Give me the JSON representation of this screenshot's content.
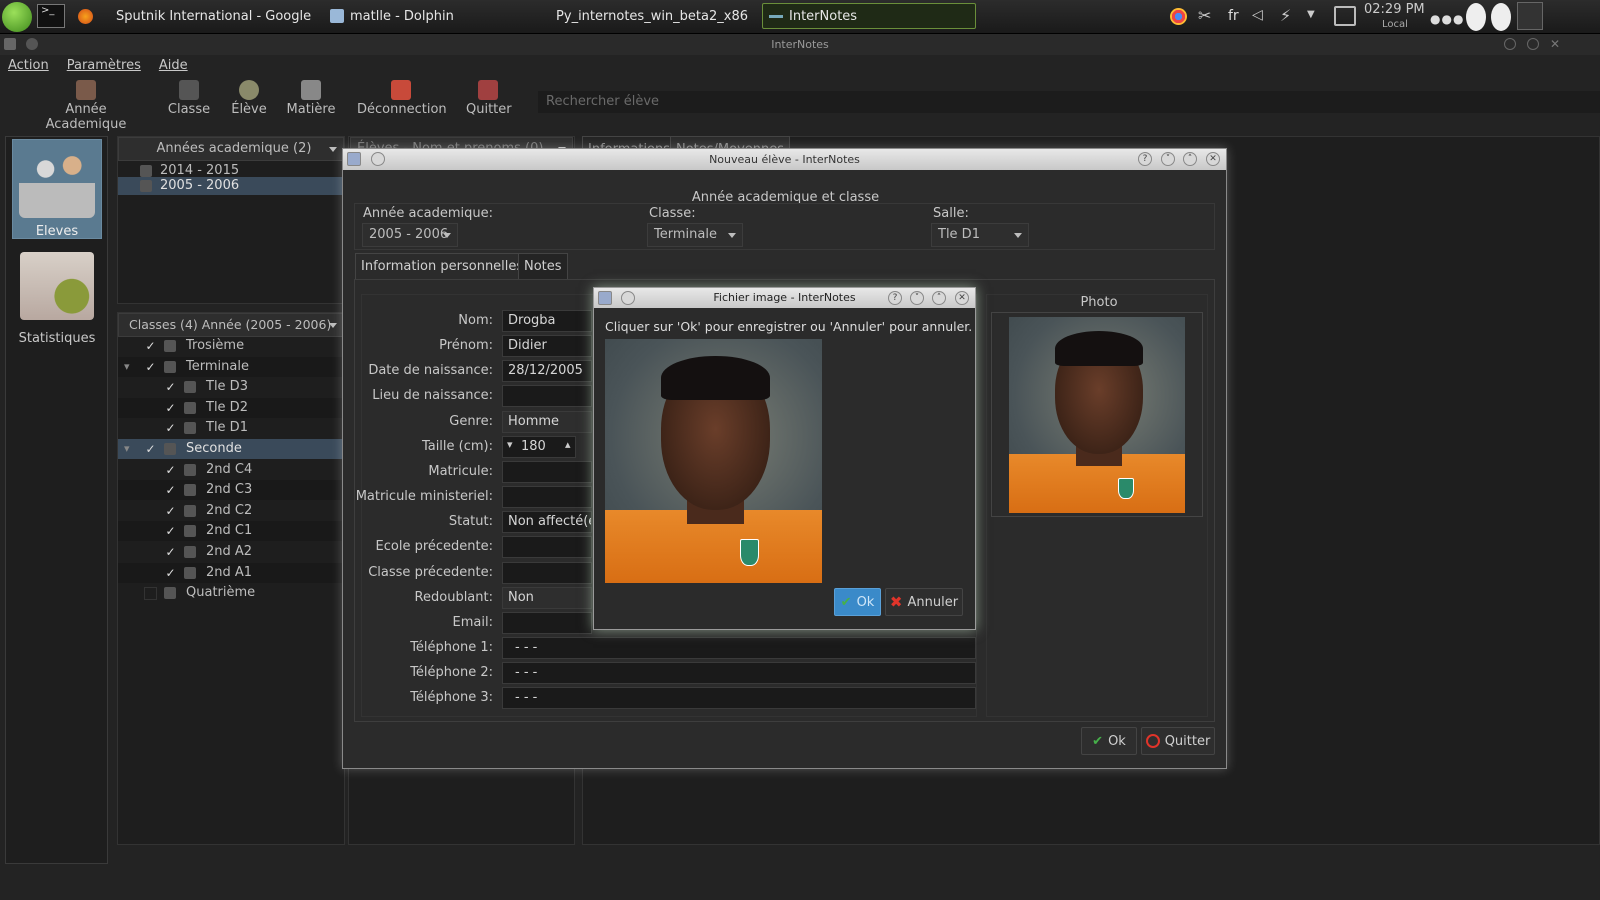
{
  "taskbar": {
    "tasks": [
      "Sputnik International - Google",
      "matlle - Dolphin",
      "Py_internotes_win_beta2_x86",
      "InterNotes"
    ],
    "lang": "fr",
    "clock": "02:29 PM",
    "clock_sub": "Local"
  },
  "app": {
    "title": "InterNotes",
    "menu": [
      "Action",
      "Paramètres",
      "Aide"
    ],
    "toolbar": [
      "Année Academique",
      "Classe",
      "Élève",
      "Matière",
      "Déconnection",
      "Quitter"
    ],
    "search_placeholder": "Rechercher élève",
    "nav": [
      "Eleves",
      "Statistiques"
    ]
  },
  "years_panel": {
    "header": "Années academique (2)",
    "items": [
      "2014 - 2015",
      "2005 - 2006"
    ],
    "selected_index": 1
  },
  "classes_panel": {
    "header": "Classes (4) Année (2005 - 2006)",
    "rows": [
      {
        "label": "Trosième",
        "level": 0,
        "checked": true,
        "expandable": false
      },
      {
        "label": "Terminale",
        "level": 0,
        "checked": true,
        "expandable": true
      },
      {
        "label": "Tle D3",
        "level": 1,
        "checked": true
      },
      {
        "label": "Tle D2",
        "level": 1,
        "checked": true
      },
      {
        "label": "Tle D1",
        "level": 1,
        "checked": true
      },
      {
        "label": "Seconde",
        "level": 0,
        "checked": true,
        "expandable": true,
        "selected": true
      },
      {
        "label": "2nd C4",
        "level": 1,
        "checked": true
      },
      {
        "label": "2nd C3",
        "level": 1,
        "checked": true
      },
      {
        "label": "2nd C2",
        "level": 1,
        "checked": true
      },
      {
        "label": "2nd C1",
        "level": 1,
        "checked": true
      },
      {
        "label": "2nd A2",
        "level": 1,
        "checked": true
      },
      {
        "label": "2nd A1",
        "level": 1,
        "checked": true
      },
      {
        "label": "Quatrième",
        "level": 0,
        "checked": false,
        "expandable": false
      }
    ]
  },
  "background_tabs": [
    "Élèves - Nom et prenoms (0)",
    "Informations",
    "Notes/Moyennes"
  ],
  "new_student_dialog": {
    "title": "Nouveau élève - InterNotes",
    "section_title": "Année academique et classe",
    "year_label": "Année academique:",
    "year_value": "2005 - 2006",
    "class_label": "Classe:",
    "class_value": "Terminale",
    "room_label": "Salle:",
    "room_value": "Tle D1",
    "tabs": [
      "Information personnelles",
      "Notes"
    ],
    "fields": [
      {
        "label": "Nom:",
        "value": "Drogba"
      },
      {
        "label": "Prénom:",
        "value": "Didier"
      },
      {
        "label": "Date de naissance:",
        "value": "28/12/2005"
      },
      {
        "label": "Lieu de naissance:",
        "value": ""
      },
      {
        "label": "Genre:",
        "value": "Homme"
      },
      {
        "label": "Taille (cm):",
        "value": "180"
      },
      {
        "label": "Matricule:",
        "value": ""
      },
      {
        "label": "Matricule ministeriel:",
        "value": ""
      },
      {
        "label": "Statut:",
        "value": "Non affecté(e)"
      },
      {
        "label": "Ecole précedente:",
        "value": ""
      },
      {
        "label": "Classe précedente:",
        "value": ""
      },
      {
        "label": "Redoublant:",
        "value": "Non"
      },
      {
        "label": "Email:",
        "value": ""
      },
      {
        "label": "Téléphone 1:",
        "value": "- - -"
      },
      {
        "label": "Téléphone 2:",
        "value": "- - -"
      },
      {
        "label": "Téléphone 3:",
        "value": "- - -"
      }
    ],
    "photo_label": "Photo",
    "ok_label": "Ok",
    "quit_label": "Quitter"
  },
  "image_dialog": {
    "title": "Fichier image - InterNotes",
    "message": "Cliquer sur 'Ok' pour enregistrer ou 'Annuler' pour annuler.",
    "ok_label": "Ok",
    "cancel_label": "Annuler"
  },
  "colors": {
    "accent": "#3a9ad9",
    "selection": "#3a4a5a",
    "ok_green": "#46b04a",
    "cancel_red": "#e0342a"
  }
}
